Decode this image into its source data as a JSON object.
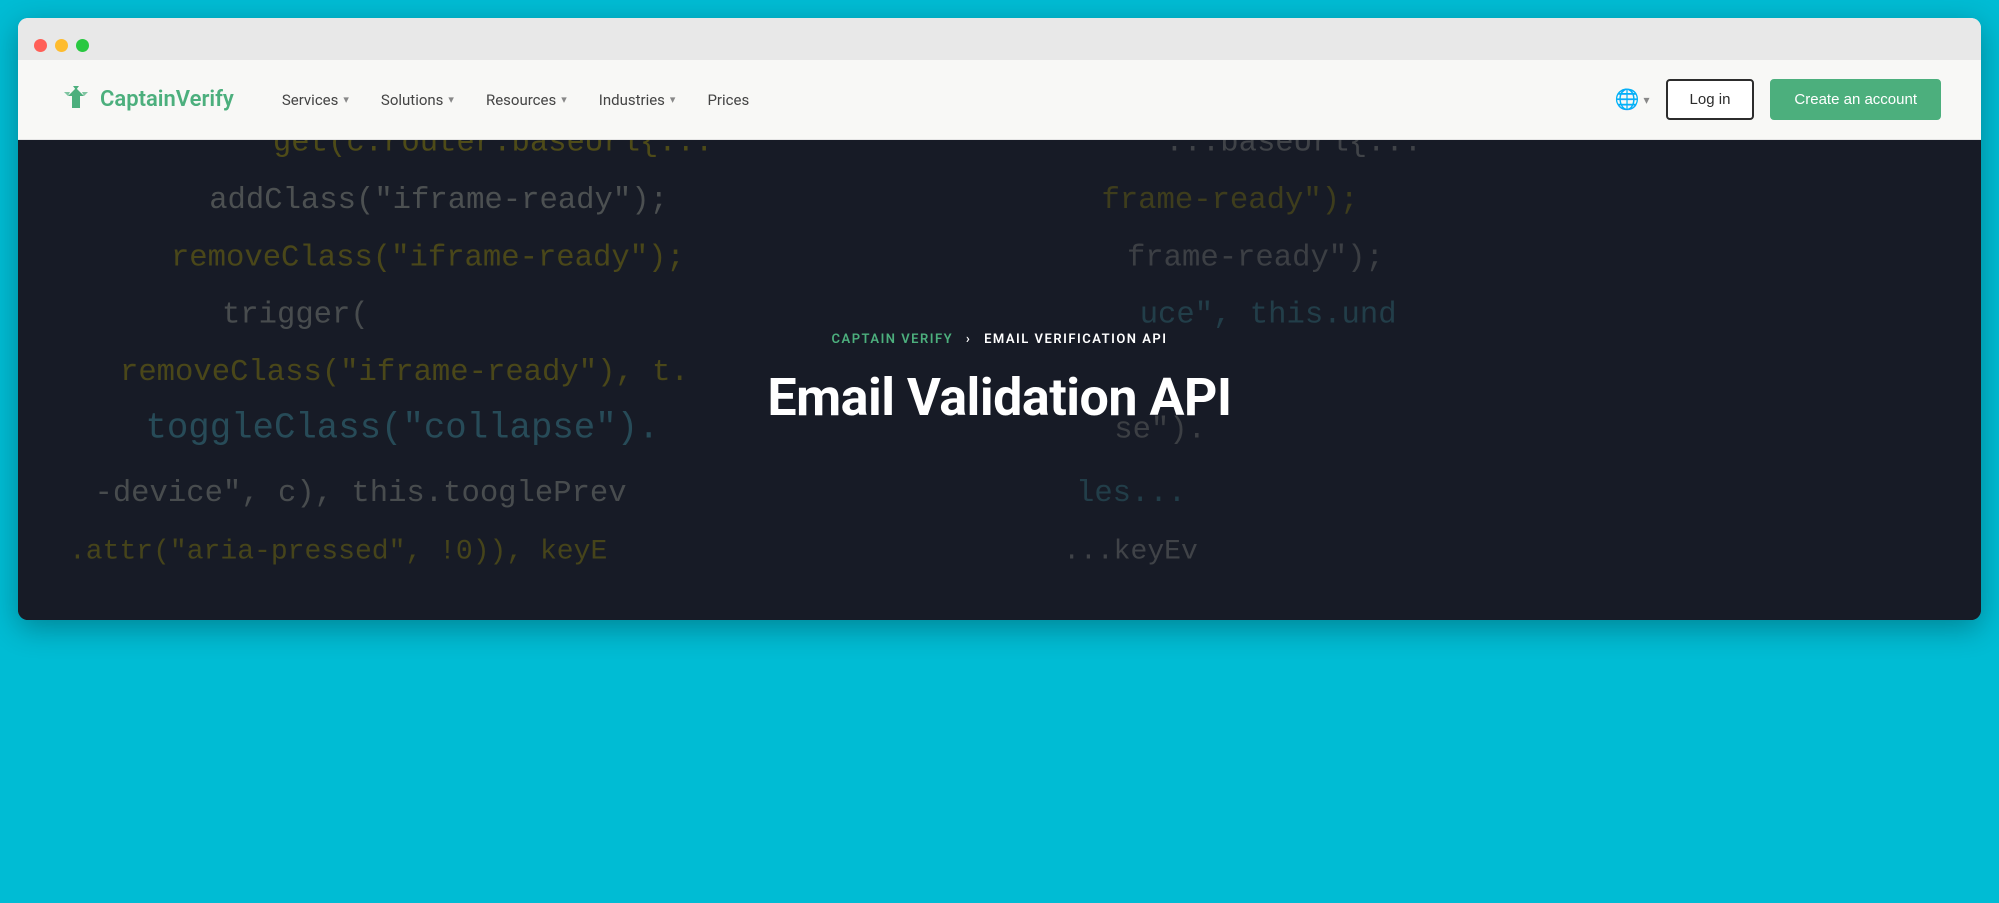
{
  "browser": {
    "traffic_lights": [
      "red",
      "yellow",
      "green"
    ]
  },
  "navbar": {
    "logo": {
      "text_captain": "Captain",
      "text_verify": "Verify"
    },
    "nav_items": [
      {
        "label": "Services",
        "has_dropdown": true
      },
      {
        "label": "Solutions",
        "has_dropdown": true
      },
      {
        "label": "Resources",
        "has_dropdown": true
      },
      {
        "label": "Industries",
        "has_dropdown": true
      },
      {
        "label": "Prices",
        "has_dropdown": false
      }
    ],
    "login_label": "Log in",
    "create_account_label": "Create an account",
    "lang_chevron": "▾"
  },
  "hero": {
    "breadcrumb_parent": "CAPTAIN VERIFY",
    "breadcrumb_separator": "›",
    "breadcrumb_current": "EMAIL VERIFICATION API",
    "title": "Email Validation API",
    "code_lines": [
      "get(c.router.baseUrl{...",
      "    addClass(\"iframe-ready\");",
      "    removeClass(\"iframe-ready\");",
      "    trigger(",
      "    removeClass(\"iframe-ready\"), t.",
      "    toggleClass(\"collapse\").",
      "    -device\", c), this.tooglePrev",
      "    .attr(\"aria-pressed\", !0)), keyE"
    ]
  },
  "colors": {
    "brand_green": "#4caf7d",
    "bg_teal": "#00bcd4",
    "hero_dark": "#1a1a2e",
    "nav_bg": "#f8f8f6"
  }
}
